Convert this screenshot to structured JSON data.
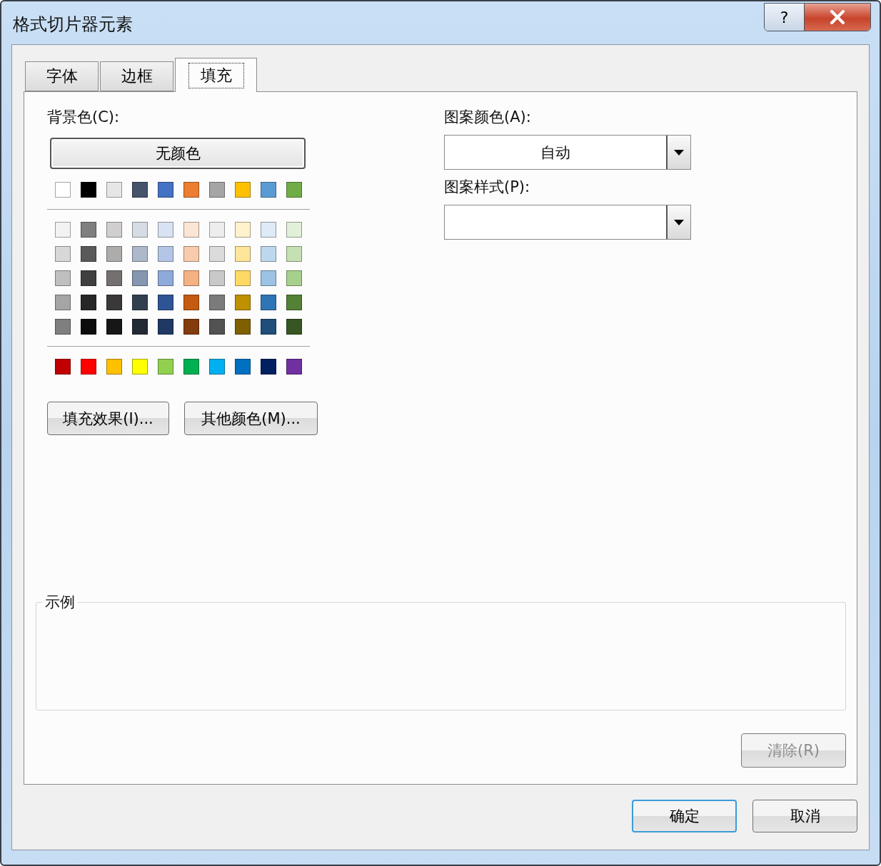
{
  "window": {
    "title": "格式切片器元素",
    "help_button": "?"
  },
  "tabs": [
    {
      "label": "字体",
      "selected": false
    },
    {
      "label": "边框",
      "selected": false
    },
    {
      "label": "填充",
      "selected": true
    }
  ],
  "background_color": {
    "label": "背景色(C):",
    "no_color_button": "无颜色",
    "theme_colors": [
      {
        "color": "#ffffff"
      },
      {
        "color": "#000000"
      },
      {
        "color": "#e7e6e6"
      },
      {
        "color": "#44546a"
      },
      {
        "color": "#4472c4"
      },
      {
        "color": "#ed7d31"
      },
      {
        "color": "#a5a5a5"
      },
      {
        "color": "#ffc000"
      },
      {
        "color": "#5b9bd5"
      },
      {
        "color": "#70ad47"
      }
    ],
    "shade_rows": [
      {
        "colors": [
          {
            "color": "#f2f2f2"
          },
          {
            "color": "#7f7f7f"
          },
          {
            "color": "#d0cece"
          },
          {
            "color": "#d6dce4"
          },
          {
            "color": "#d9e2f3"
          },
          {
            "color": "#fbe5d5"
          },
          {
            "color": "#ededed"
          },
          {
            "color": "#fff2cc"
          },
          {
            "color": "#deebf6"
          },
          {
            "color": "#e2efd9"
          }
        ]
      },
      {
        "colors": [
          {
            "color": "#d8d8d8"
          },
          {
            "color": "#595959"
          },
          {
            "color": "#aeabab"
          },
          {
            "color": "#adb9ca"
          },
          {
            "color": "#b4c6e7"
          },
          {
            "color": "#f7cbac"
          },
          {
            "color": "#dbdbdb"
          },
          {
            "color": "#fee599"
          },
          {
            "color": "#bdd7ee"
          },
          {
            "color": "#c5e0b3"
          }
        ]
      },
      {
        "colors": [
          {
            "color": "#bfbfbf"
          },
          {
            "color": "#3f3f3f"
          },
          {
            "color": "#757070"
          },
          {
            "color": "#8496b0"
          },
          {
            "color": "#8eaadb"
          },
          {
            "color": "#f4b183"
          },
          {
            "color": "#c9c9c9"
          },
          {
            "color": "#ffd965"
          },
          {
            "color": "#9cc3e5"
          },
          {
            "color": "#a8d08d"
          }
        ]
      },
      {
        "colors": [
          {
            "color": "#a5a5a5"
          },
          {
            "color": "#262626"
          },
          {
            "color": "#3a3838"
          },
          {
            "color": "#323f4f"
          },
          {
            "color": "#2f5496"
          },
          {
            "color": "#c55a11"
          },
          {
            "color": "#7b7b7b"
          },
          {
            "color": "#bf9000"
          },
          {
            "color": "#2e75b5"
          },
          {
            "color": "#538135"
          }
        ]
      },
      {
        "colors": [
          {
            "color": "#7f7f7f"
          },
          {
            "color": "#0c0c0c"
          },
          {
            "color": "#171616"
          },
          {
            "color": "#222a35"
          },
          {
            "color": "#1f3864"
          },
          {
            "color": "#833c0b"
          },
          {
            "color": "#525252"
          },
          {
            "color": "#7f6000"
          },
          {
            "color": "#1e4e79"
          },
          {
            "color": "#375623"
          }
        ]
      }
    ],
    "standard_colors": [
      {
        "color": "#c00000"
      },
      {
        "color": "#ff0000"
      },
      {
        "color": "#ffc000"
      },
      {
        "color": "#ffff00"
      },
      {
        "color": "#92d050"
      },
      {
        "color": "#00b050"
      },
      {
        "color": "#00b0f0"
      },
      {
        "color": "#0070c0"
      },
      {
        "color": "#002060"
      },
      {
        "color": "#7030a0"
      }
    ],
    "buttons": [
      "填充效果(I)...",
      "其他颜色(M)..."
    ]
  },
  "pattern_color": {
    "label": "图案颜色(A):",
    "value": "自动"
  },
  "pattern_style": {
    "label": "图案样式(P):"
  },
  "sample": {
    "label": "示例"
  },
  "clear_button": {
    "label": "清除(R)",
    "disabled": true
  },
  "footer_buttons": [
    {
      "label": "确定",
      "default": true
    },
    {
      "label": "取消",
      "default": false
    }
  ]
}
